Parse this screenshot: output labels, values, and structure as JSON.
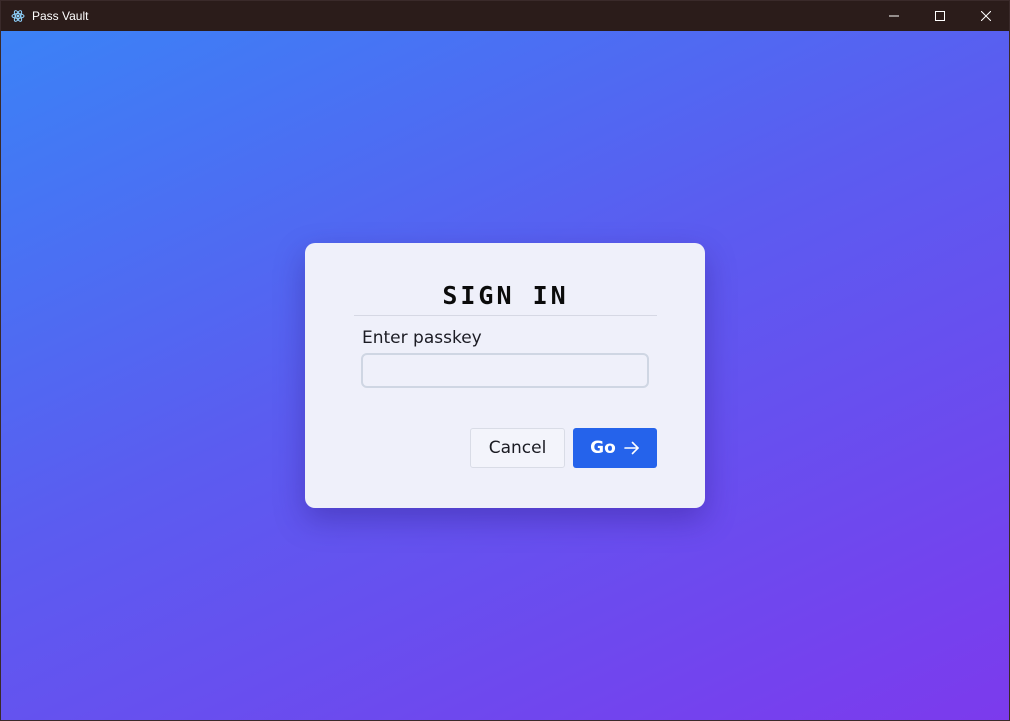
{
  "window": {
    "title": "Pass Vault",
    "app_icon": "atom-icon",
    "controls": [
      "minimize-icon",
      "maximize-icon",
      "close-icon"
    ]
  },
  "background": {
    "gradient_start": "#3b82f6",
    "gradient_end": "#7c3aed"
  },
  "signin": {
    "title": "SIGN IN",
    "field_label": "Enter passkey",
    "input_value": "",
    "cancel_label": "Cancel",
    "go_label": "Go",
    "go_icon": "arrow-right-icon",
    "accent": "#2563eb"
  }
}
